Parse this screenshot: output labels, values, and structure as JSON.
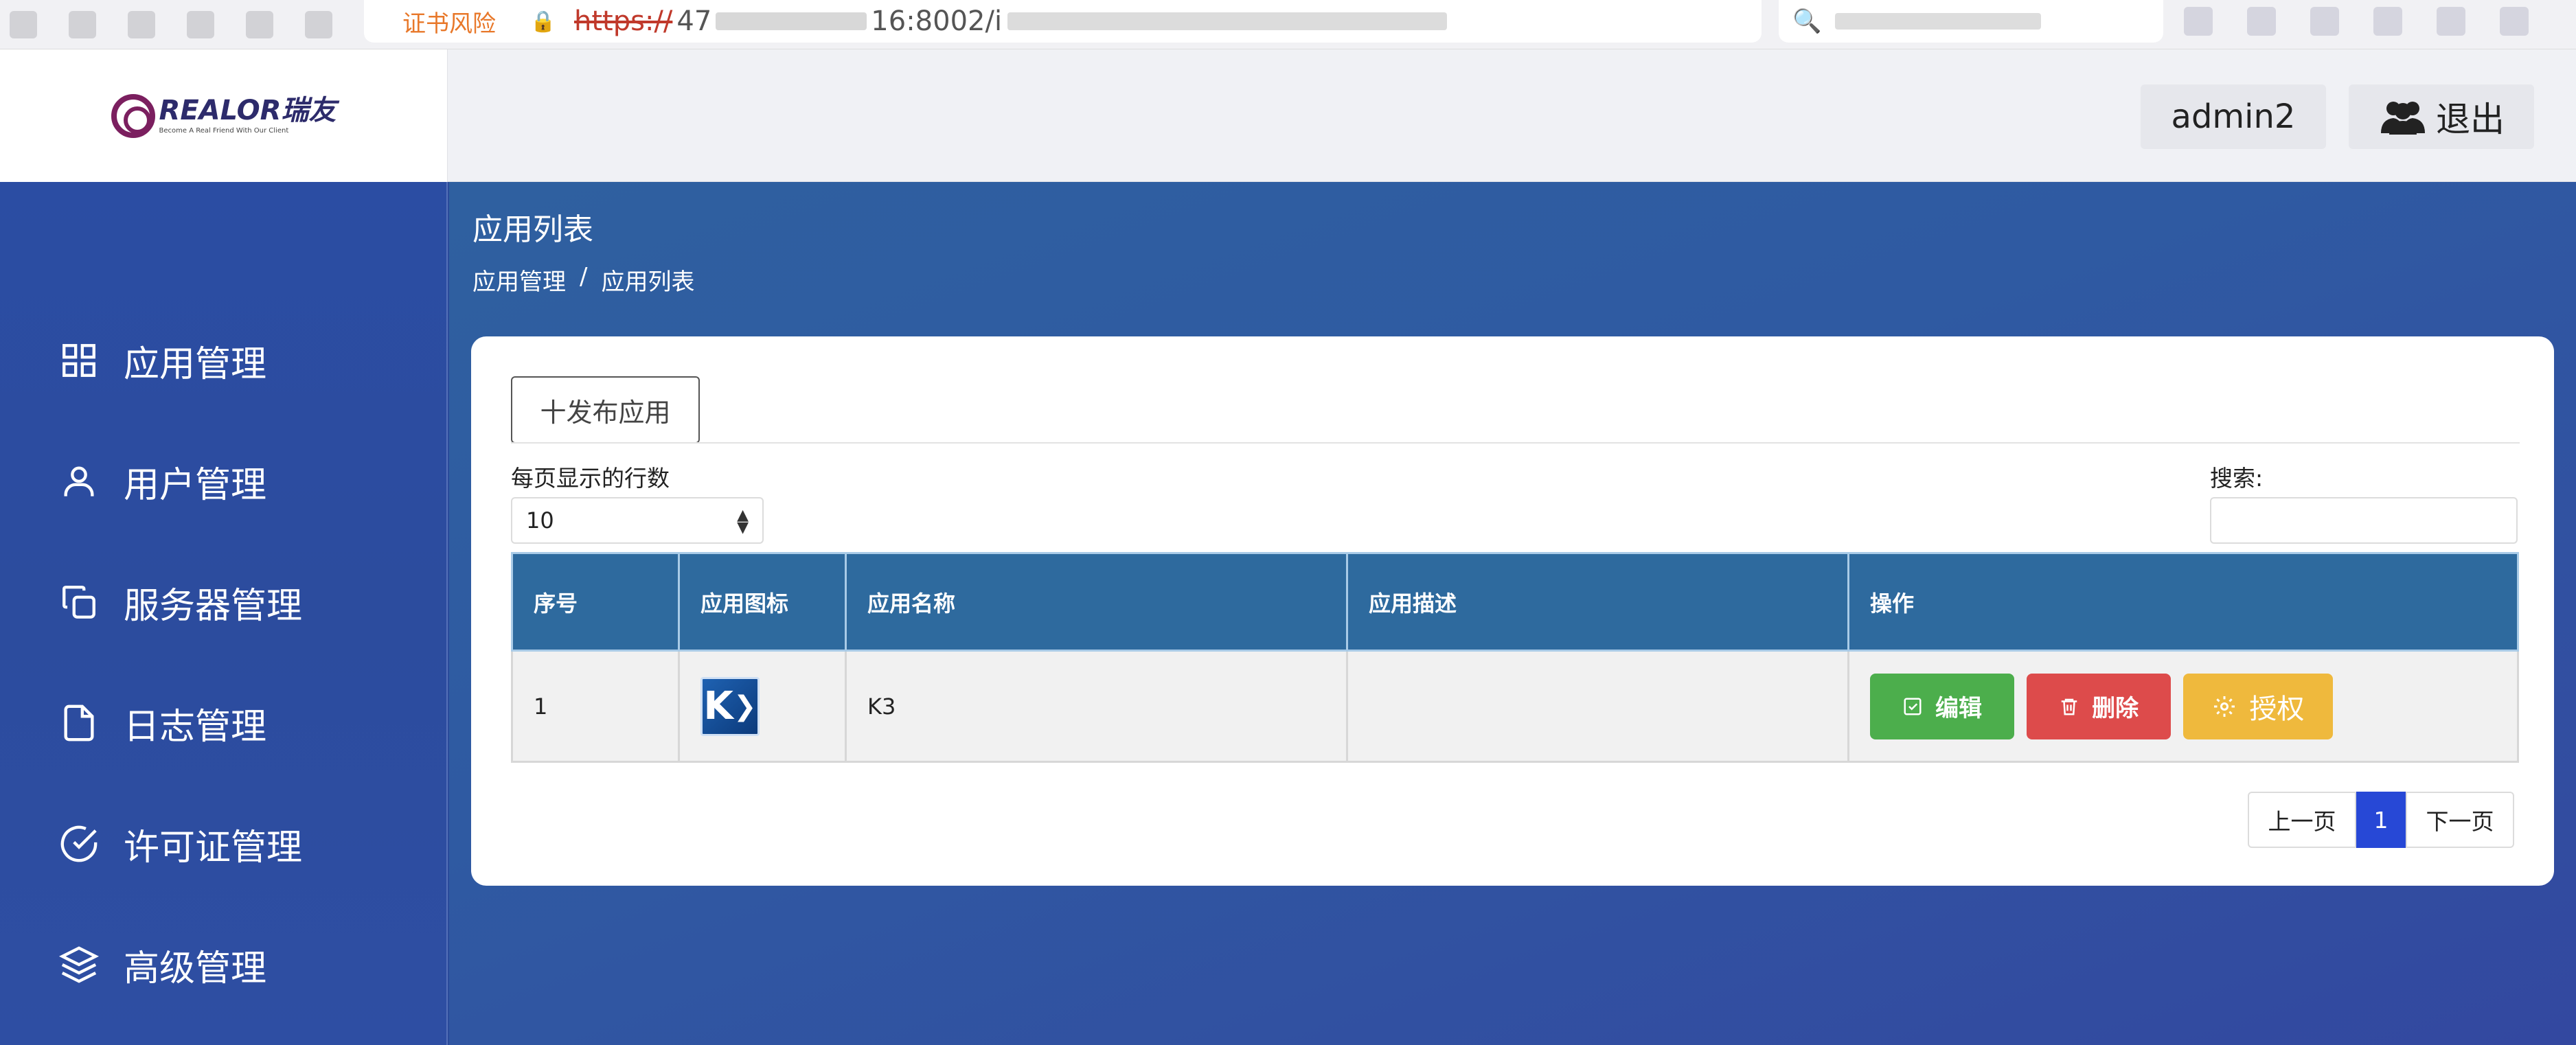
{
  "browser": {
    "cert_warning": "证书风险",
    "url_scheme": "https://",
    "url_host_prefix": "47",
    "url_port": "16:8002/i"
  },
  "header": {
    "logo_text": "REALOR瑞友",
    "logo_sub": "Become A Real Friend With Our Client",
    "user": "admin2",
    "logout": "退出"
  },
  "sidebar": {
    "items": [
      {
        "label": "应用管理",
        "icon": "grid-icon"
      },
      {
        "label": "用户管理",
        "icon": "user-icon"
      },
      {
        "label": "服务器管理",
        "icon": "copy-icon"
      },
      {
        "label": "日志管理",
        "icon": "file-icon"
      },
      {
        "label": "许可证管理",
        "icon": "check-circle-icon"
      },
      {
        "label": "高级管理",
        "icon": "layers-icon"
      }
    ]
  },
  "main": {
    "page_title": "应用列表",
    "breadcrumb": [
      "应用管理",
      "/",
      "应用列表"
    ],
    "publish_button": "十发布应用",
    "rows_per_page_label": "每页显示的行数",
    "rows_per_page_value": "10",
    "search_label": "搜索:",
    "table": {
      "headers": [
        "序号",
        "应用图标",
        "应用名称",
        "应用描述",
        "操作"
      ],
      "rows": [
        {
          "index": "1",
          "icon_text": "K",
          "name": "K3",
          "description": ""
        }
      ]
    },
    "actions": {
      "edit": "编辑",
      "delete": "删除",
      "authorize": "授权"
    },
    "pager": {
      "prev": "上一页",
      "current": "1",
      "next": "下一页"
    }
  }
}
